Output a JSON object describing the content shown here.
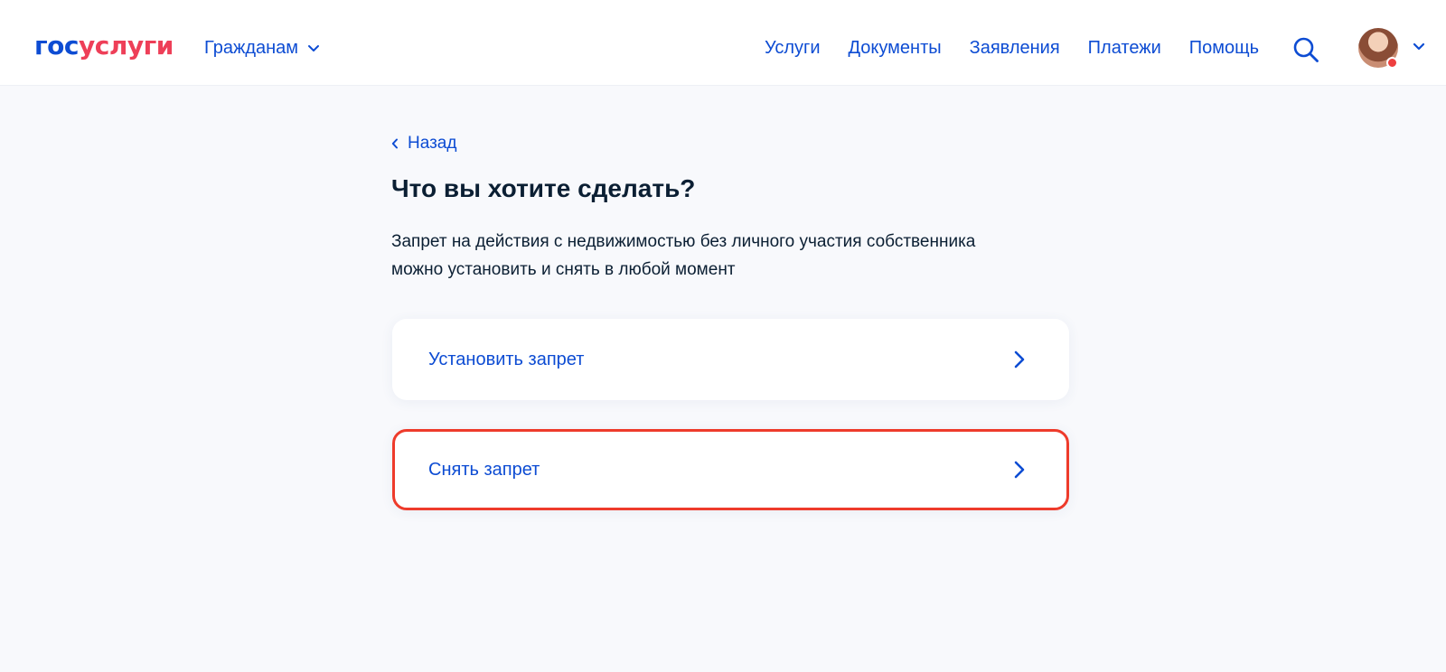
{
  "header": {
    "logo_part1": "гос",
    "logo_part2": "услуги",
    "citizen_menu": "Гражданам",
    "nav": [
      {
        "label": "Услуги"
      },
      {
        "label": "Документы"
      },
      {
        "label": "Заявления"
      },
      {
        "label": "Платежи"
      },
      {
        "label": "Помощь"
      }
    ],
    "notification_color": "#ee3f3f"
  },
  "main": {
    "back_label": "Назад",
    "title": "Что вы хотите сделать?",
    "description_line1": "Запрет на действия с недвижимостью без личного участия собственника",
    "description_line2": "можно установить и снять в любой момент",
    "options": [
      {
        "label": "Установить запрет"
      },
      {
        "label": "Снять запрет"
      }
    ]
  },
  "colors": {
    "brand_blue": "#0d4cd3",
    "brand_red": "#ee3f58",
    "highlight_border": "#ee3b2b",
    "page_bg": "#f8f9fc"
  },
  "icons": {
    "menu_chevron": "chevron-down-icon",
    "search": "search-icon",
    "back": "chevron-left-icon",
    "option_arrow": "chevron-right-icon"
  }
}
